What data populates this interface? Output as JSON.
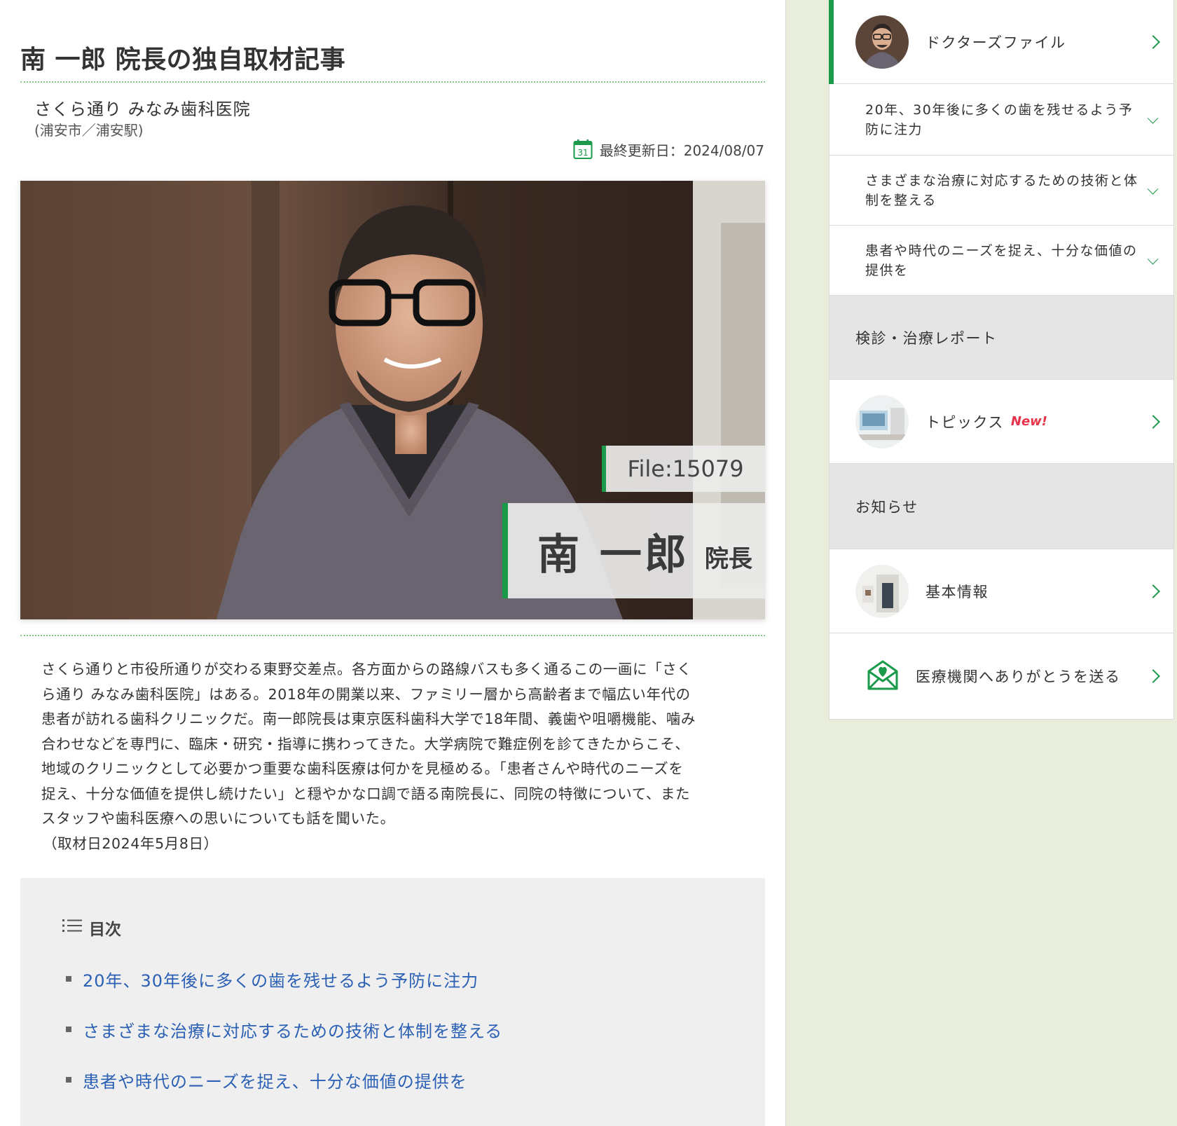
{
  "article": {
    "title": "南 一郎 院長の独自取材記事",
    "clinic_name": "さくら通り みなみ歯科医院",
    "location": "(浦安市／浦安駅)",
    "calendar_day": "31",
    "updated_label": "最終更新日：2024/08/07",
    "hero": {
      "file_label": "File:15079",
      "doctor_name": "南 一郎",
      "doctor_role": "院長"
    },
    "intro_lines": "さくら通りと市役所通りが交わる東野交差点。各方面からの路線バスも多く通るこの一画に「さく\nら通り みなみ歯科医院」はある。2018年の開業以来、ファミリー層から高齢者まで幅広い年代の\n患者が訪れる歯科クリニックだ。南一郎院長は東京医科歯科大学で18年間、義歯や咀嚼機能、噛み\n合わせなどを専門に、臨床・研究・指導に携わってきた。大学病院で難症例を診てきたからこそ、\n地域のクリニックとして必要かつ重要な歯科医療は何かを見極める。「患者さんや時代のニーズを\n捉え、十分な価値を提供し続けたい」と穏やかな口調で語る南院長に、同院の特徴について、また\nスタッフや歯科医療への思いについても話を聞いた。",
    "interview_date": "（取材日2024年5月8日）"
  },
  "toc": {
    "heading": "目次",
    "items": [
      "20年、30年後に多くの歯を残せるよう予防に注力",
      "さまざまな治療に対応するための技術と体制を整える",
      "患者や時代のニーズを捉え、十分な価値の提供を"
    ]
  },
  "sidebar": {
    "doctors_file": "ドクターズファイル",
    "sub_items": [
      "20年、30年後に多くの歯を残せるよう予防に注力",
      "さまざまな治療に対応するための技術と体制を整える",
      "患者や時代のニーズを捉え、十分な価値の提供を"
    ],
    "report": "検診・治療レポート",
    "topics": "トピックス",
    "topics_badge": "New!",
    "news": "お知らせ",
    "basic_info": "基本情報",
    "thanks": "医療機関へありがとうを送る"
  },
  "colors": {
    "accent_green": "#1a9a4a",
    "link_blue": "#2b60b5",
    "new_red": "#e8334a",
    "page_bg": "#e8eedb"
  }
}
